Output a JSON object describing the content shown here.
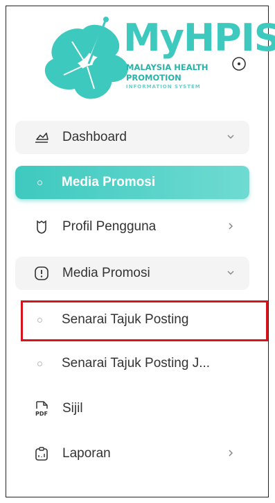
{
  "brand": {
    "title": "MyHPIS",
    "line1": "MALAYSIA HEALTH",
    "line2": "PROMOTION",
    "line3": "INFORMATION SYSTEM",
    "color": "#3ec9bf"
  },
  "settings_icon": "circle-dot-icon",
  "menu": {
    "dashboard": {
      "label": "Dashboard",
      "icon": "dashboard-icon",
      "chevron": "chevron-down"
    },
    "media_promosi_active": {
      "label": "Media Promosi"
    },
    "profil": {
      "label": "Profil Pengguna",
      "icon": "shield-icon",
      "chevron": "chevron-right"
    },
    "media_promosi": {
      "label": "Media Promosi",
      "icon": "alert-circle-icon",
      "chevron": "chevron-down"
    },
    "senarai": {
      "label": "Senarai Tajuk Posting"
    },
    "senarai_j": {
      "label": "Senarai Tajuk Posting J..."
    },
    "sijil": {
      "label": "Sijil",
      "icon": "pdf-icon"
    },
    "laporan": {
      "label": "Laporan",
      "icon": "clipboard-icon",
      "chevron": "chevron-right"
    }
  },
  "colors": {
    "accent": "#3ec9bf",
    "highlight": "#d6141d"
  }
}
